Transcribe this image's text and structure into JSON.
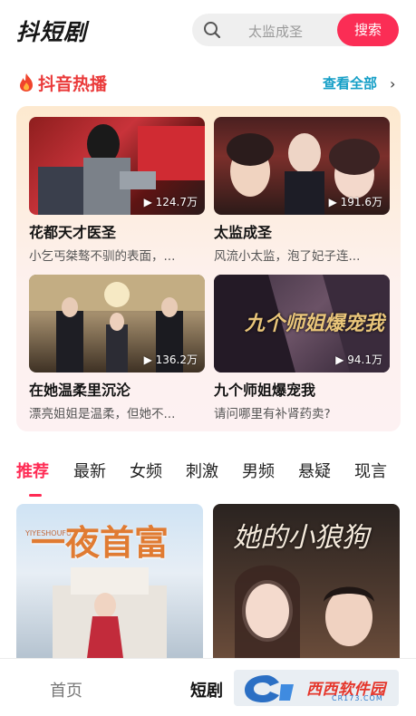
{
  "header": {
    "logo": "抖短剧",
    "search_placeholder": "太监成圣",
    "search_button": "搜索"
  },
  "hot": {
    "title": "抖音热播",
    "see_all": "查看全部",
    "items": [
      {
        "title": "花都天才医圣",
        "desc": "小乞丐桀骜不驯的表面，",
        "views": "124.7万"
      },
      {
        "title": "太监成圣",
        "desc": "风流小太监，泡了妃子连",
        "views": "191.6万"
      },
      {
        "title": "在她温柔里沉沦",
        "desc": "漂亮姐姐是温柔，但她不",
        "views": "136.2万"
      },
      {
        "title": "九个师姐爆宠我",
        "desc": "请问哪里有补肾药卖?",
        "views": "94.1万"
      }
    ],
    "more_marker": "...",
    "poster_text": "九个师姐爆宠我"
  },
  "tabs": [
    "推荐",
    "最新",
    "女频",
    "刺激",
    "男频",
    "悬疑",
    "现言"
  ],
  "posters": [
    {
      "title_art": "一夜首富",
      "subtitle": "YIYESHOUFU"
    },
    {
      "title_art": "她的小狼狗",
      "subtitle": ""
    }
  ],
  "bottom_nav": {
    "home": "首页",
    "short": "短剧"
  },
  "watermark": {
    "text": "西西软件园",
    "sub": "CR173.COM"
  },
  "colors": {
    "accent": "#fb2d55",
    "hot_title": "#ea3a3a",
    "link": "#169fc7"
  }
}
